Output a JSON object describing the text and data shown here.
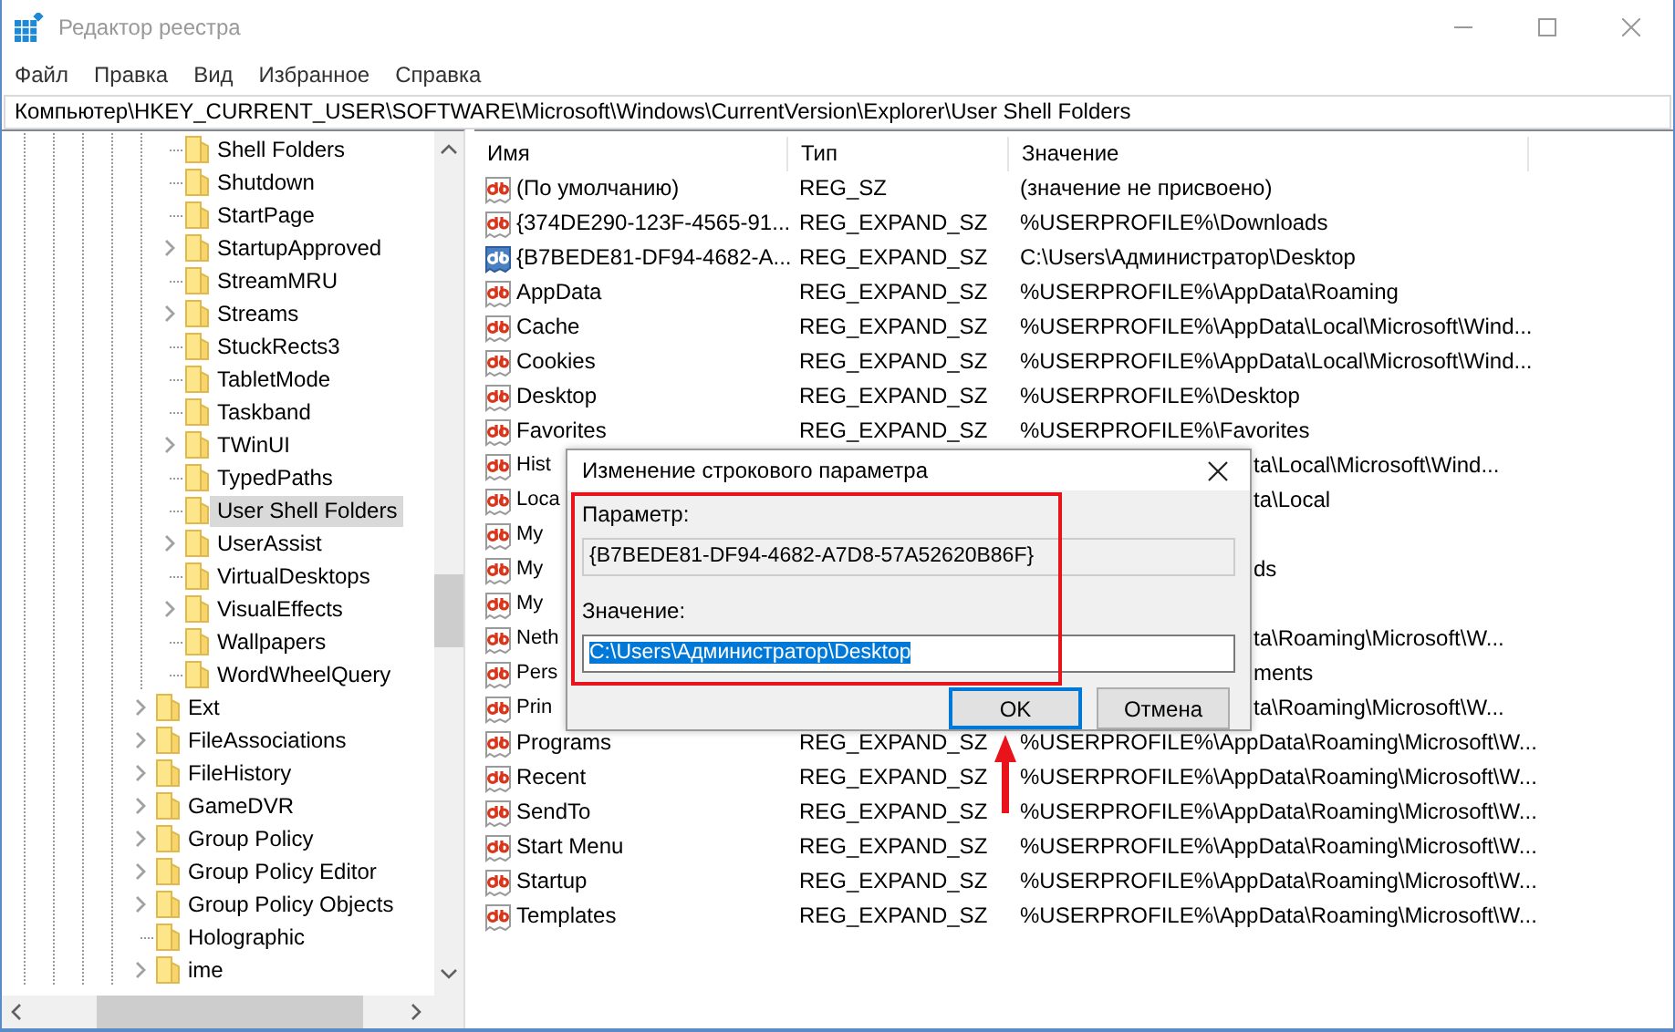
{
  "window": {
    "title": "Редактор реестра"
  },
  "menu": [
    "Файл",
    "Правка",
    "Вид",
    "Избранное",
    "Справка"
  ],
  "address": "Компьютер\\HKEY_CURRENT_USER\\SOFTWARE\\Microsoft\\Windows\\CurrentVersion\\Explorer\\User Shell Folders",
  "tree": [
    {
      "children": [
        {
          "label": "Shell Folders",
          "expandable": false,
          "selected": false
        },
        {
          "label": "Shutdown",
          "expandable": false,
          "selected": false
        },
        {
          "label": "StartPage",
          "expandable": false,
          "selected": false
        },
        {
          "label": "StartupApproved",
          "expandable": true,
          "selected": false
        },
        {
          "label": "StreamMRU",
          "expandable": false,
          "selected": false
        },
        {
          "label": "Streams",
          "expandable": true,
          "selected": false
        },
        {
          "label": "StuckRects3",
          "expandable": false,
          "selected": false
        },
        {
          "label": "TabletMode",
          "expandable": false,
          "selected": false
        },
        {
          "label": "Taskband",
          "expandable": false,
          "selected": false
        },
        {
          "label": "TWinUI",
          "expandable": true,
          "selected": false
        },
        {
          "label": "TypedPaths",
          "expandable": false,
          "selected": false
        },
        {
          "label": "User Shell Folders",
          "expandable": false,
          "selected": true
        },
        {
          "label": "UserAssist",
          "expandable": true,
          "selected": false
        },
        {
          "label": "VirtualDesktops",
          "expandable": false,
          "selected": false
        },
        {
          "label": "VisualEffects",
          "expandable": true,
          "selected": false
        },
        {
          "label": "Wallpapers",
          "expandable": false,
          "selected": false
        },
        {
          "label": "WordWheelQuery",
          "expandable": false,
          "selected": false
        }
      ]
    },
    {
      "label": "Ext",
      "expandable": true,
      "selected": false
    },
    {
      "label": "FileAssociations",
      "expandable": true,
      "selected": false
    },
    {
      "label": "FileHistory",
      "expandable": true,
      "selected": false
    },
    {
      "label": "GameDVR",
      "expandable": true,
      "selected": false
    },
    {
      "label": "Group Policy",
      "expandable": true,
      "selected": false
    },
    {
      "label": "Group Policy Editor",
      "expandable": true,
      "selected": false
    },
    {
      "label": "Group Policy Objects",
      "expandable": true,
      "selected": false
    },
    {
      "label": "Holographic",
      "expandable": false,
      "selected": false
    },
    {
      "label": "ime",
      "expandable": true,
      "selected": false
    }
  ],
  "table": {
    "columns": [
      "Имя",
      "Тип",
      "Значение"
    ],
    "rows": [
      {
        "kind": "full",
        "name": "(По умолчанию)",
        "type": "REG_SZ",
        "value": "(значение не присвоено)",
        "selected": false
      },
      {
        "kind": "full",
        "name": "{374DE290-123F-4565-91...",
        "type": "REG_EXPAND_SZ",
        "value": "%USERPROFILE%\\Downloads",
        "selected": false
      },
      {
        "kind": "full",
        "name": "{B7BEDE81-DF94-4682-A...",
        "type": "REG_EXPAND_SZ",
        "value": "C:\\Users\\Администратор\\Desktop",
        "selected": true
      },
      {
        "kind": "full",
        "name": "AppData",
        "type": "REG_EXPAND_SZ",
        "value": "%USERPROFILE%\\AppData\\Roaming",
        "selected": false
      },
      {
        "kind": "full",
        "name": "Cache",
        "type": "REG_EXPAND_SZ",
        "value": "%USERPROFILE%\\AppData\\Local\\Microsoft\\Wind...",
        "selected": false
      },
      {
        "kind": "full",
        "name": "Cookies",
        "type": "REG_EXPAND_SZ",
        "value": "%USERPROFILE%\\AppData\\Local\\Microsoft\\Wind...",
        "selected": false
      },
      {
        "kind": "full",
        "name": "Desktop",
        "type": "REG_EXPAND_SZ",
        "value": "%USERPROFILE%\\Desktop",
        "selected": false
      },
      {
        "kind": "full",
        "name": "Favorites",
        "type": "REG_EXPAND_SZ",
        "value": "%USERPROFILE%\\Favorites",
        "selected": false
      },
      {
        "kind": "covered",
        "name": "Hist",
        "value": "ta\\Local\\Microsoft\\Wind...",
        "selected": false
      },
      {
        "kind": "covered",
        "name": "Loca",
        "value": "ta\\Local",
        "selected": false
      },
      {
        "kind": "covered",
        "name": "My",
        "selected": false
      },
      {
        "kind": "covered",
        "name": "My",
        "value": "ds",
        "selected": false
      },
      {
        "kind": "covered",
        "name": "My",
        "selected": false
      },
      {
        "kind": "covered",
        "name": "Neth",
        "value": "ta\\Roaming\\Microsoft\\W...",
        "selected": false
      },
      {
        "kind": "covered",
        "name": "Pers",
        "value": "ments",
        "selected": false
      },
      {
        "kind": "covered",
        "name": "Prin",
        "value": "ta\\Roaming\\Microsoft\\W...",
        "selected": false
      },
      {
        "kind": "full",
        "name": "Programs",
        "type": "REG_EXPAND_SZ",
        "value": "%USERPROFILE%\\AppData\\Roaming\\Microsoft\\W...",
        "selected": false
      },
      {
        "kind": "full",
        "name": "Recent",
        "type": "REG_EXPAND_SZ",
        "value": "%USERPROFILE%\\AppData\\Roaming\\Microsoft\\W...",
        "selected": false
      },
      {
        "kind": "full",
        "name": "SendTo",
        "type": "REG_EXPAND_SZ",
        "value": "%USERPROFILE%\\AppData\\Roaming\\Microsoft\\W...",
        "selected": false
      },
      {
        "kind": "full",
        "name": "Start Menu",
        "type": "REG_EXPAND_SZ",
        "value": "%USERPROFILE%\\AppData\\Roaming\\Microsoft\\W...",
        "selected": false
      },
      {
        "kind": "full",
        "name": "Startup",
        "type": "REG_EXPAND_SZ",
        "value": "%USERPROFILE%\\AppData\\Roaming\\Microsoft\\W...",
        "selected": false
      },
      {
        "kind": "full",
        "name": "Templates",
        "type": "REG_EXPAND_SZ",
        "value": "%USERPROFILE%\\AppData\\Roaming\\Microsoft\\W...",
        "selected": false
      }
    ]
  },
  "dialog": {
    "title": "Изменение строкового параметра",
    "name_label": "Параметр:",
    "name_value": "{B7BEDE81-DF94-4682-A7D8-57A52620B86F}",
    "value_label": "Значение:",
    "value_value": "C:\\Users\\Администратор\\Desktop",
    "value_selected": true,
    "buttons": [
      {
        "label": "OK",
        "default": true
      },
      {
        "label": "Отмена",
        "default": false
      }
    ]
  }
}
